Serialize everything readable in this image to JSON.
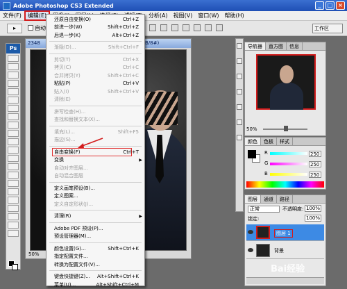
{
  "window": {
    "title": "Adobe Photoshop CS3 Extended"
  },
  "menubar": [
    "文件(F)",
    "编辑(E)",
    "图像(I)",
    "图层(L)",
    "选择(S)",
    "滤镜(T)",
    "分析(A)",
    "视图(V)",
    "窗口(W)",
    "帮助(H)"
  ],
  "options": {
    "auto_select": "自动",
    "workspace": "工作区"
  },
  "document": {
    "tab": "2348",
    "zoom": "50%",
    "tab_suffix": "B/8#)"
  },
  "edit_menu": [
    {
      "label": "还原自由变换(O)",
      "shortcut": "Ctrl+Z",
      "enabled": true
    },
    {
      "label": "前进一步(W)",
      "shortcut": "Shift+Ctrl+Z",
      "enabled": true
    },
    {
      "label": "后退一步(K)",
      "shortcut": "Alt+Ctrl+Z",
      "enabled": true
    },
    {
      "sep": true
    },
    {
      "label": "渐隐(D)...",
      "shortcut": "Shift+Ctrl+F",
      "enabled": false
    },
    {
      "sep": true
    },
    {
      "label": "剪切(T)",
      "shortcut": "Ctrl+X",
      "enabled": false
    },
    {
      "label": "拷贝(C)",
      "shortcut": "Ctrl+C",
      "enabled": false
    },
    {
      "label": "合并拷贝(Y)",
      "shortcut": "Shift+Ctrl+C",
      "enabled": false
    },
    {
      "label": "粘贴(P)",
      "shortcut": "Ctrl+V",
      "enabled": true
    },
    {
      "label": "贴入(I)",
      "shortcut": "Shift+Ctrl+V",
      "enabled": false
    },
    {
      "label": "清除(E)",
      "shortcut": "",
      "enabled": false
    },
    {
      "sep": true
    },
    {
      "label": "拼写检查(H)...",
      "shortcut": "",
      "enabled": false
    },
    {
      "label": "查找和替换文本(X)...",
      "shortcut": "",
      "enabled": false
    },
    {
      "sep": true
    },
    {
      "label": "填充(L)...",
      "shortcut": "Shift+F5",
      "enabled": false
    },
    {
      "label": "描边(S)...",
      "shortcut": "",
      "enabled": false
    },
    {
      "sep": true
    },
    {
      "label": "自由变换(F)",
      "shortcut": "Ctrl+T",
      "enabled": true,
      "highlight": true
    },
    {
      "label": "变换",
      "shortcut": "",
      "enabled": true,
      "submenu": true
    },
    {
      "label": "自动对齐图层...",
      "shortcut": "",
      "enabled": false
    },
    {
      "label": "自动混合图层",
      "shortcut": "",
      "enabled": false
    },
    {
      "sep": true
    },
    {
      "label": "定义画笔预设(B)...",
      "shortcut": "",
      "enabled": true
    },
    {
      "label": "定义图案...",
      "shortcut": "",
      "enabled": true
    },
    {
      "label": "定义自定形状(J)...",
      "shortcut": "",
      "enabled": false
    },
    {
      "sep": true
    },
    {
      "label": "清理(R)",
      "shortcut": "",
      "enabled": true,
      "submenu": true
    },
    {
      "sep": true
    },
    {
      "label": "Adobe PDF 预设(P)...",
      "shortcut": "",
      "enabled": true
    },
    {
      "label": "预设管理器(M)...",
      "shortcut": "",
      "enabled": true
    },
    {
      "sep": true
    },
    {
      "label": "颜色设置(G)...",
      "shortcut": "Shift+Ctrl+K",
      "enabled": true
    },
    {
      "label": "指定配置文件...",
      "shortcut": "",
      "enabled": true
    },
    {
      "label": "转换为配置文件(V)...",
      "shortcut": "",
      "enabled": true
    },
    {
      "sep": true
    },
    {
      "label": "键盘快捷键(Z)...",
      "shortcut": "Alt+Shift+Ctrl+K",
      "enabled": true
    },
    {
      "label": "菜单(U)...",
      "shortcut": "Alt+Shift+Ctrl+M",
      "enabled": true
    }
  ],
  "navigator": {
    "tabs": [
      "导航器",
      "直方图",
      "信息"
    ],
    "zoom": "50%"
  },
  "color_panel": {
    "tabs": [
      "颜色",
      "色板",
      "样式"
    ],
    "channels": [
      {
        "name": "R",
        "value": "250"
      },
      {
        "name": "G",
        "value": "250"
      },
      {
        "name": "B",
        "value": "250"
      }
    ]
  },
  "layers_panel": {
    "tabs": [
      "图层",
      "通道",
      "路径"
    ],
    "blend_mode": "正常",
    "opacity_label": "不透明度:",
    "opacity": "100%",
    "lock_label": "锁定:",
    "fill": "100%",
    "layers": [
      {
        "name": "图层 1",
        "selected": true
      },
      {
        "name": "背景",
        "selected": false
      }
    ]
  },
  "watermark": "Bai经验"
}
